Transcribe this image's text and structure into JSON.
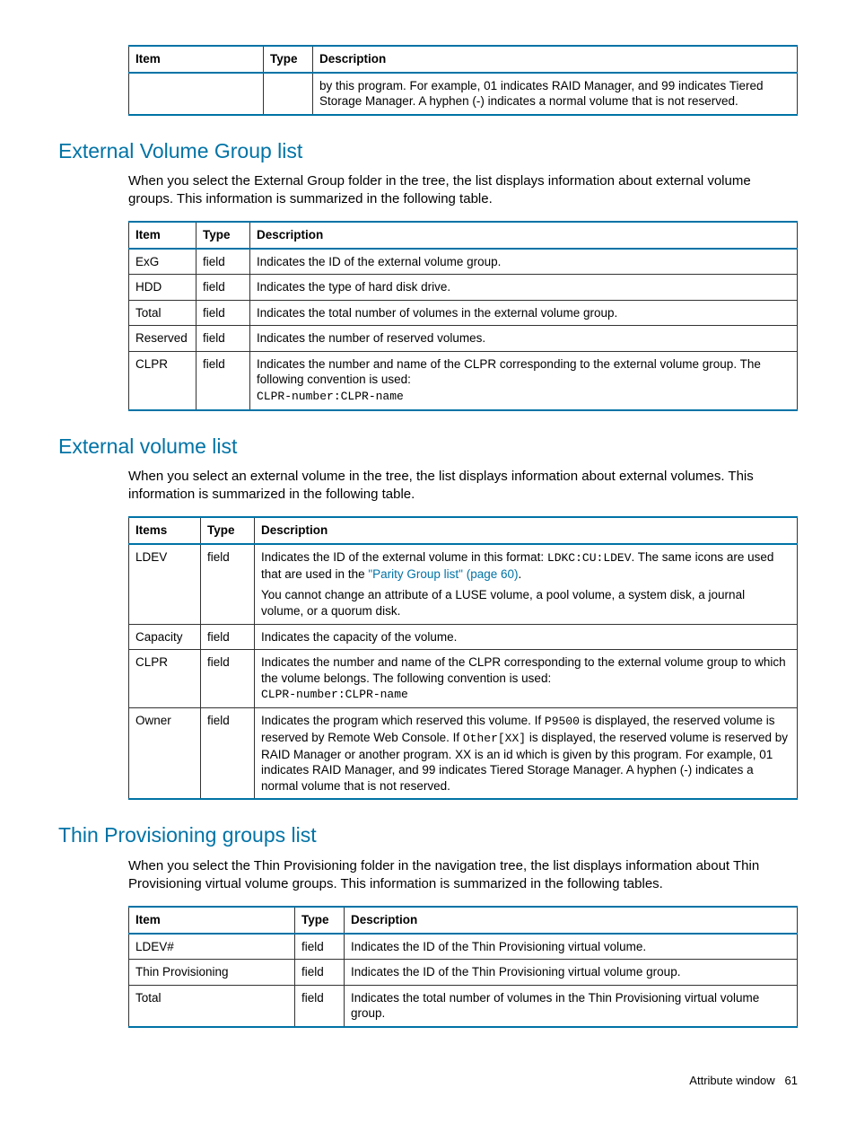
{
  "table1": {
    "headers": {
      "item": "Item",
      "type": "Type",
      "desc": "Description"
    },
    "row": {
      "item": "",
      "type": "",
      "desc": "by this program. For example, 01 indicates RAID Manager, and 99 indicates Tiered Storage Manager. A hyphen (-) indicates a normal volume that is not reserved."
    }
  },
  "section1": {
    "heading": "External Volume Group list",
    "para": "When you select the External Group folder in the tree, the list displays information about external volume groups. This information is summarized in the following table.",
    "headers": {
      "item": "Item",
      "type": "Type",
      "desc": "Description"
    },
    "rows": [
      {
        "item": "ExG",
        "type": "field",
        "desc": "Indicates the ID of the external volume group."
      },
      {
        "item": "HDD",
        "type": "field",
        "desc": "Indicates the type of hard disk drive."
      },
      {
        "item": "Total",
        "type": "field",
        "desc": "Indicates the total number of volumes in the external volume group."
      },
      {
        "item": "Reserved",
        "type": "field",
        "desc": "Indicates the number of reserved volumes."
      },
      {
        "item": "CLPR",
        "type": "field",
        "desc": "Indicates the number and name of the CLPR corresponding to the external volume group. The following convention is used:",
        "code": "CLPR-number:CLPR-name"
      }
    ]
  },
  "section2": {
    "heading": "External volume list",
    "para": "When you select an external volume in the tree, the list displays information about external volumes. This information is summarized in the following table.",
    "headers": {
      "item": "Items",
      "type": "Type",
      "desc": "Description"
    },
    "rows": {
      "ldev": {
        "item": "LDEV",
        "type": "field",
        "desc_a": "Indicates the ID of the external volume in this format: ",
        "code_a": "LDKC:CU:LDEV",
        "desc_b": ". The same icons are used that are used in the ",
        "link": "\"Parity Group list\" (page 60)",
        "desc_c": ".",
        "desc_d": "You cannot change an attribute of a LUSE volume, a pool volume, a system disk, a journal volume, or a quorum disk."
      },
      "capacity": {
        "item": "Capacity",
        "type": "field",
        "desc": "Indicates the capacity of the volume."
      },
      "clpr": {
        "item": "CLPR",
        "type": "field",
        "desc": "Indicates the number and name of the CLPR corresponding to the external volume group to which the volume belongs. The following convention is used:",
        "code": "CLPR-number:CLPR-name"
      },
      "owner": {
        "item": "Owner",
        "type": "field",
        "desc_a": "Indicates the program which reserved this volume. If ",
        "code_a": "P9500",
        "desc_b": " is displayed, the reserved volume is reserved by Remote Web Console. If ",
        "code_b": "Other[XX]",
        "desc_c": " is displayed, the reserved volume is reserved by RAID Manager or another program. XX is an id which is given by this program. For example, 01 indicates RAID Manager, and 99 indicates Tiered Storage Manager. A hyphen (-) indicates a normal volume that is not reserved."
      }
    }
  },
  "section3": {
    "heading": "Thin Provisioning groups list",
    "para": "When you select the Thin Provisioning folder in the navigation tree, the list displays information about Thin Provisioning virtual volume groups. This information is summarized in the following tables.",
    "headers": {
      "item": "Item",
      "type": "Type",
      "desc": "Description"
    },
    "rows": [
      {
        "item": "LDEV#",
        "type": "field",
        "desc": "Indicates the ID of the Thin Provisioning virtual volume."
      },
      {
        "item": "Thin Provisioning",
        "type": "field",
        "desc": "Indicates the ID of the Thin Provisioning virtual volume group."
      },
      {
        "item": "Total",
        "type": "field",
        "desc": "Indicates the total number of volumes in the Thin Provisioning virtual volume group."
      }
    ]
  },
  "footer": {
    "label": "Attribute window",
    "page": "61"
  }
}
